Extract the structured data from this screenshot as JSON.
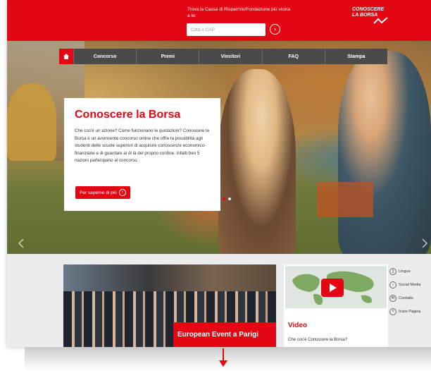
{
  "header": {
    "find_label": "Trova la Cassa di Risparmio/Fondazione più vicina a te:",
    "search_placeholder": "Città o CAP",
    "search_go_icon": "chevron-right-circle-icon",
    "logo_line1": "CONOSCERE",
    "logo_line2": "LA BORSA"
  },
  "nav": {
    "home_icon": "home-icon",
    "items": [
      {
        "label": "Concorso"
      },
      {
        "label": "Premi"
      },
      {
        "label": "Vincitori"
      },
      {
        "label": "FAQ"
      },
      {
        "label": "Stampa"
      }
    ]
  },
  "hero": {
    "title": "Conoscere la Borsa",
    "text": "Che cos'è un azione? Come funzionano le quotazioni? Conoscere la Borsa è un avvincente concorso online che offre la possibilità agli studenti delle scuole superiori di acquisire conoscenze economico-finanziarie e di guardare al di là del proprio confine. Infatti ben 5 nazioni partecipano al concorso.",
    "button_label": "Per saperne di più",
    "slides": 2,
    "active_slide": 1
  },
  "tiles": {
    "event_label": "European Event a Parigi",
    "video_title": "Video",
    "video_subtitle": "Che cos'è Conoscere la Borsa?"
  },
  "side_links": [
    {
      "label": "Lingua",
      "icon": "language-icon"
    },
    {
      "label": "Social Media",
      "icon": "share-icon"
    },
    {
      "label": "Contatto",
      "icon": "mail-icon"
    },
    {
      "label": "Inizio Pagina",
      "icon": "arrow-up-icon"
    }
  ],
  "colors": {
    "brand_red": "#e30613",
    "nav_gray": "#4a4a4a"
  }
}
